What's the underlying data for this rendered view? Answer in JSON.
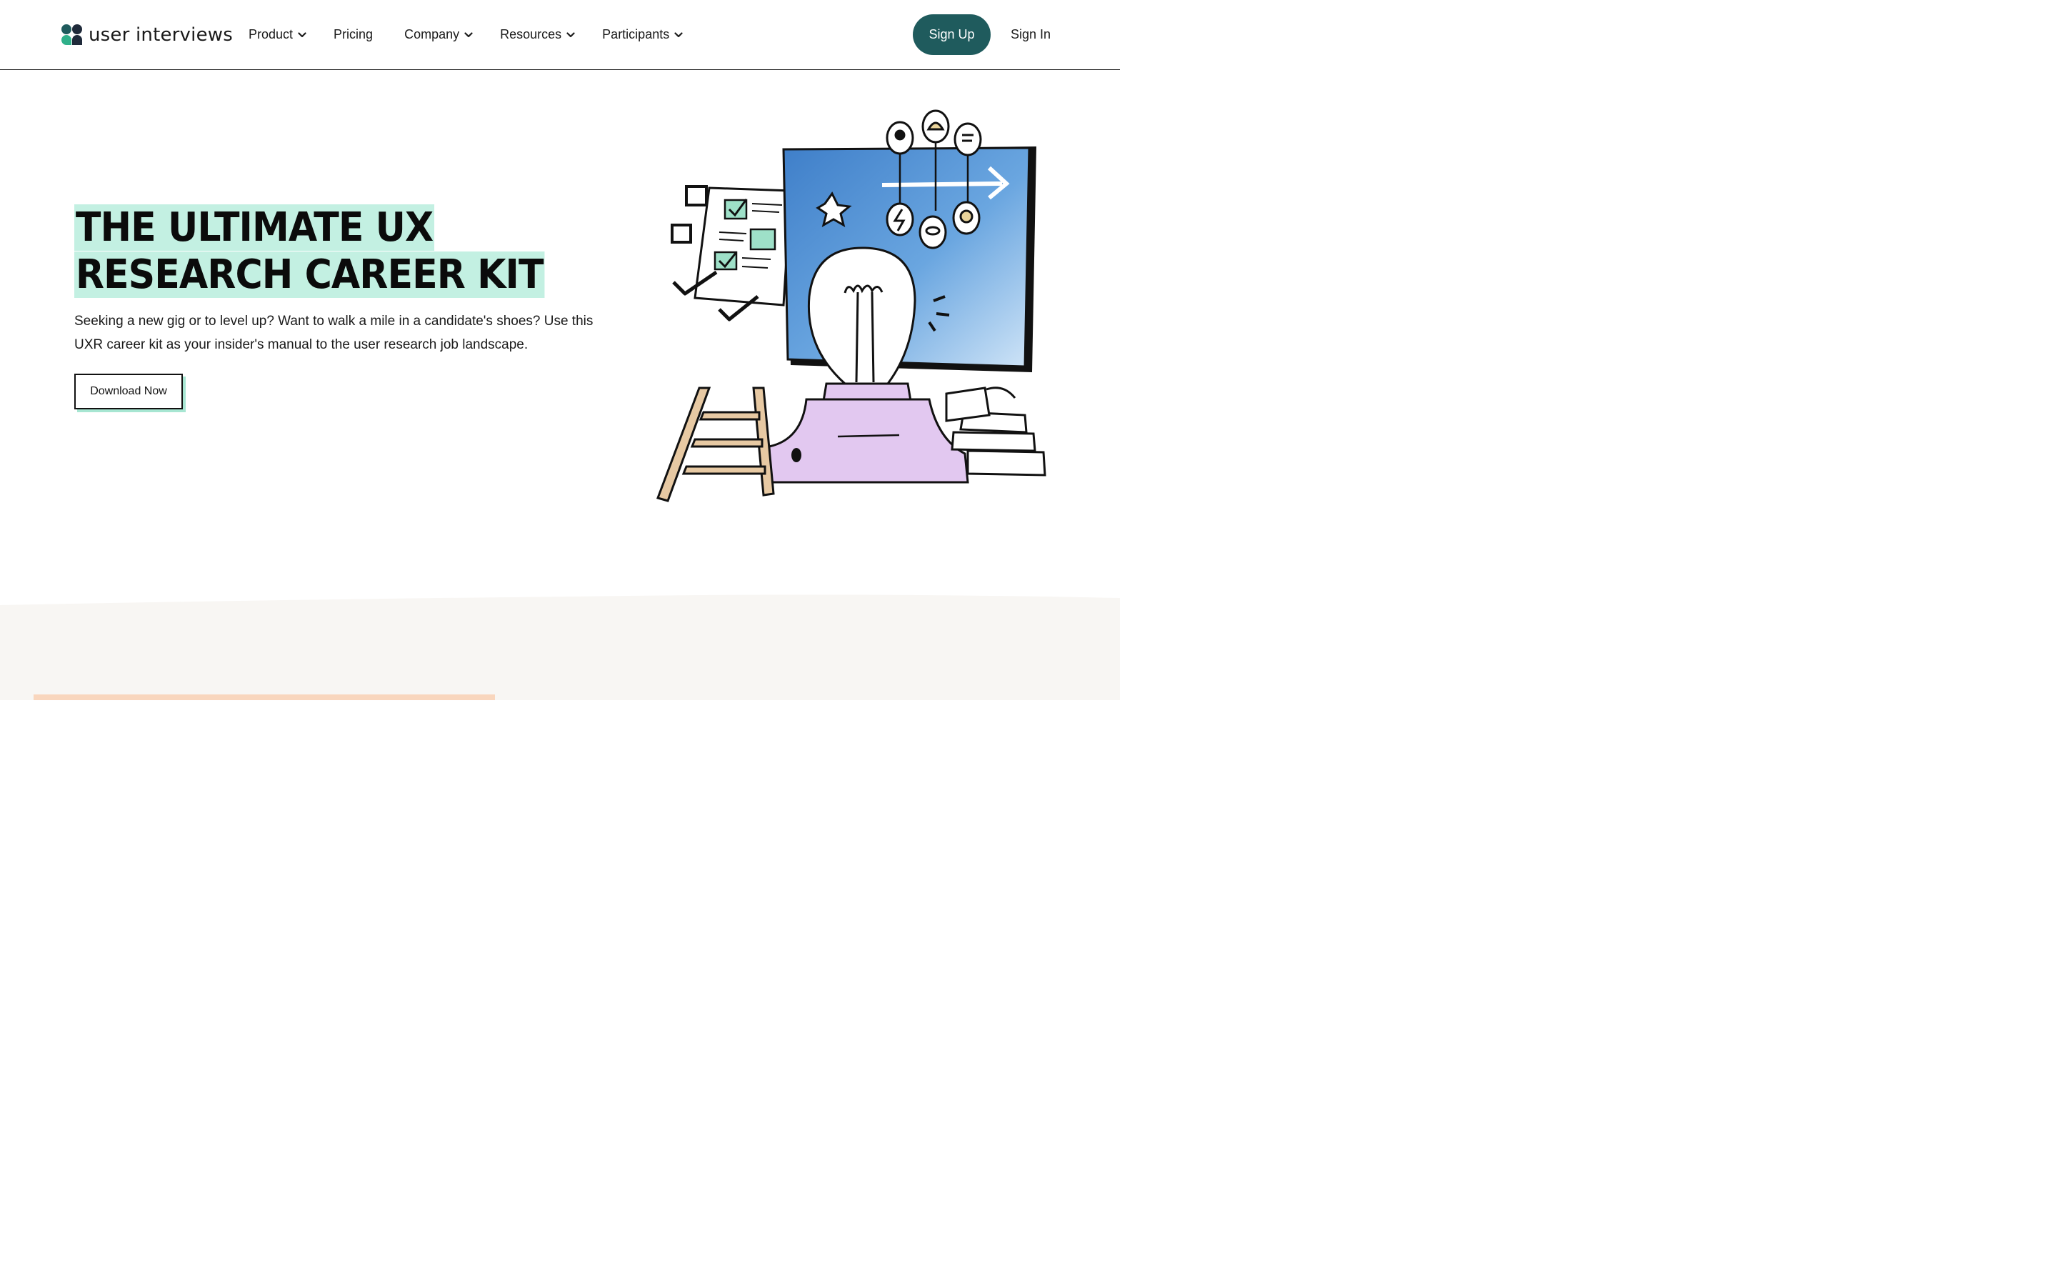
{
  "brand": {
    "name": "user interviews"
  },
  "nav": {
    "items": [
      {
        "label": "Product",
        "has_dropdown": true
      },
      {
        "label": "Pricing",
        "has_dropdown": false
      },
      {
        "label": "Company",
        "has_dropdown": true
      },
      {
        "label": "Resources",
        "has_dropdown": true
      },
      {
        "label": "Participants",
        "has_dropdown": true
      }
    ],
    "signup_label": "Sign Up",
    "signin_label": "Sign In"
  },
  "hero": {
    "title": "THE ULTIMATE UX RESEARCH CAREER KIT",
    "description": "Seeking a new gig or to level up? Want to walk a mile in a candidate's shoes? Use this UXR career kit as your insider's manual to the user research job landscape.",
    "cta_label": "Download Now"
  },
  "colors": {
    "brand_teal": "#1f5b5d",
    "highlight_mint": "#c3f0e2",
    "cta_shadow": "#a7e6d2",
    "section_bg": "#f8f6f3",
    "accent_peach": "#f9d6bd",
    "lamp_lilac": "#e2c8f0",
    "screen_blue": "#4d8fd6"
  },
  "icons": {
    "dropdown": "chevron-down-icon",
    "illustration": "lightbulb-career-illustration"
  }
}
